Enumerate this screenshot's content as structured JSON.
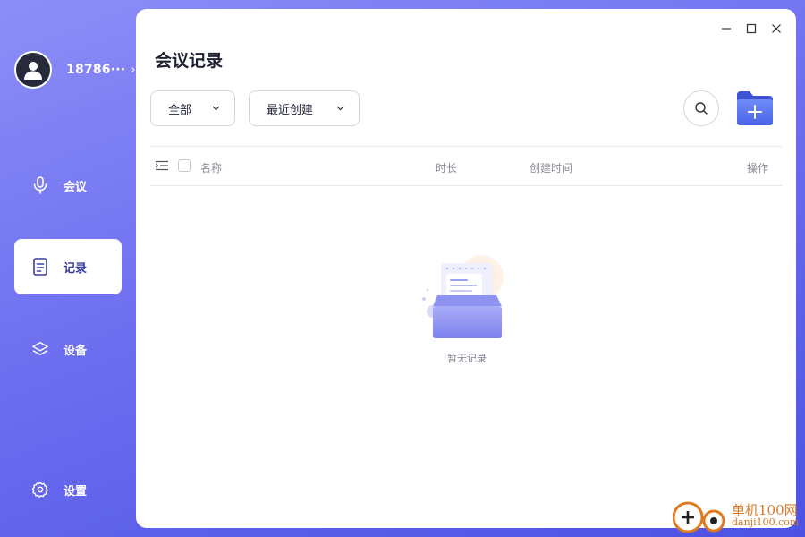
{
  "profile": {
    "name": "18786···",
    "chevron": "›"
  },
  "nav": [
    {
      "label": "会议",
      "icon": "microphone-icon"
    },
    {
      "label": "记录",
      "icon": "document-icon",
      "active": true
    },
    {
      "label": "设备",
      "icon": "layers-icon"
    },
    {
      "label": "设置",
      "icon": "gear-icon"
    }
  ],
  "window_controls": [
    "minimize",
    "maximize",
    "close"
  ],
  "page": {
    "title": "会议记录"
  },
  "filters": {
    "category_selected": "全部",
    "sort_selected": "最近创建"
  },
  "toolbar": {
    "search_icon": "search-icon",
    "new_folder_icon": "folder-plus-icon"
  },
  "table": {
    "columns": {
      "name": "名称",
      "duration": "时长",
      "created": "创建时间",
      "actions": "操作"
    },
    "rows": []
  },
  "empty_state": {
    "message": "暂无记录",
    "icon": "empty-inbox-icon"
  },
  "watermark": {
    "cn": "单机100网",
    "url": "danji100.com"
  },
  "colors": {
    "accent": "#5b5fe8",
    "sidebar_gradient_start": "#8c8ef7",
    "sidebar_gradient_end": "#4c52e3"
  }
}
